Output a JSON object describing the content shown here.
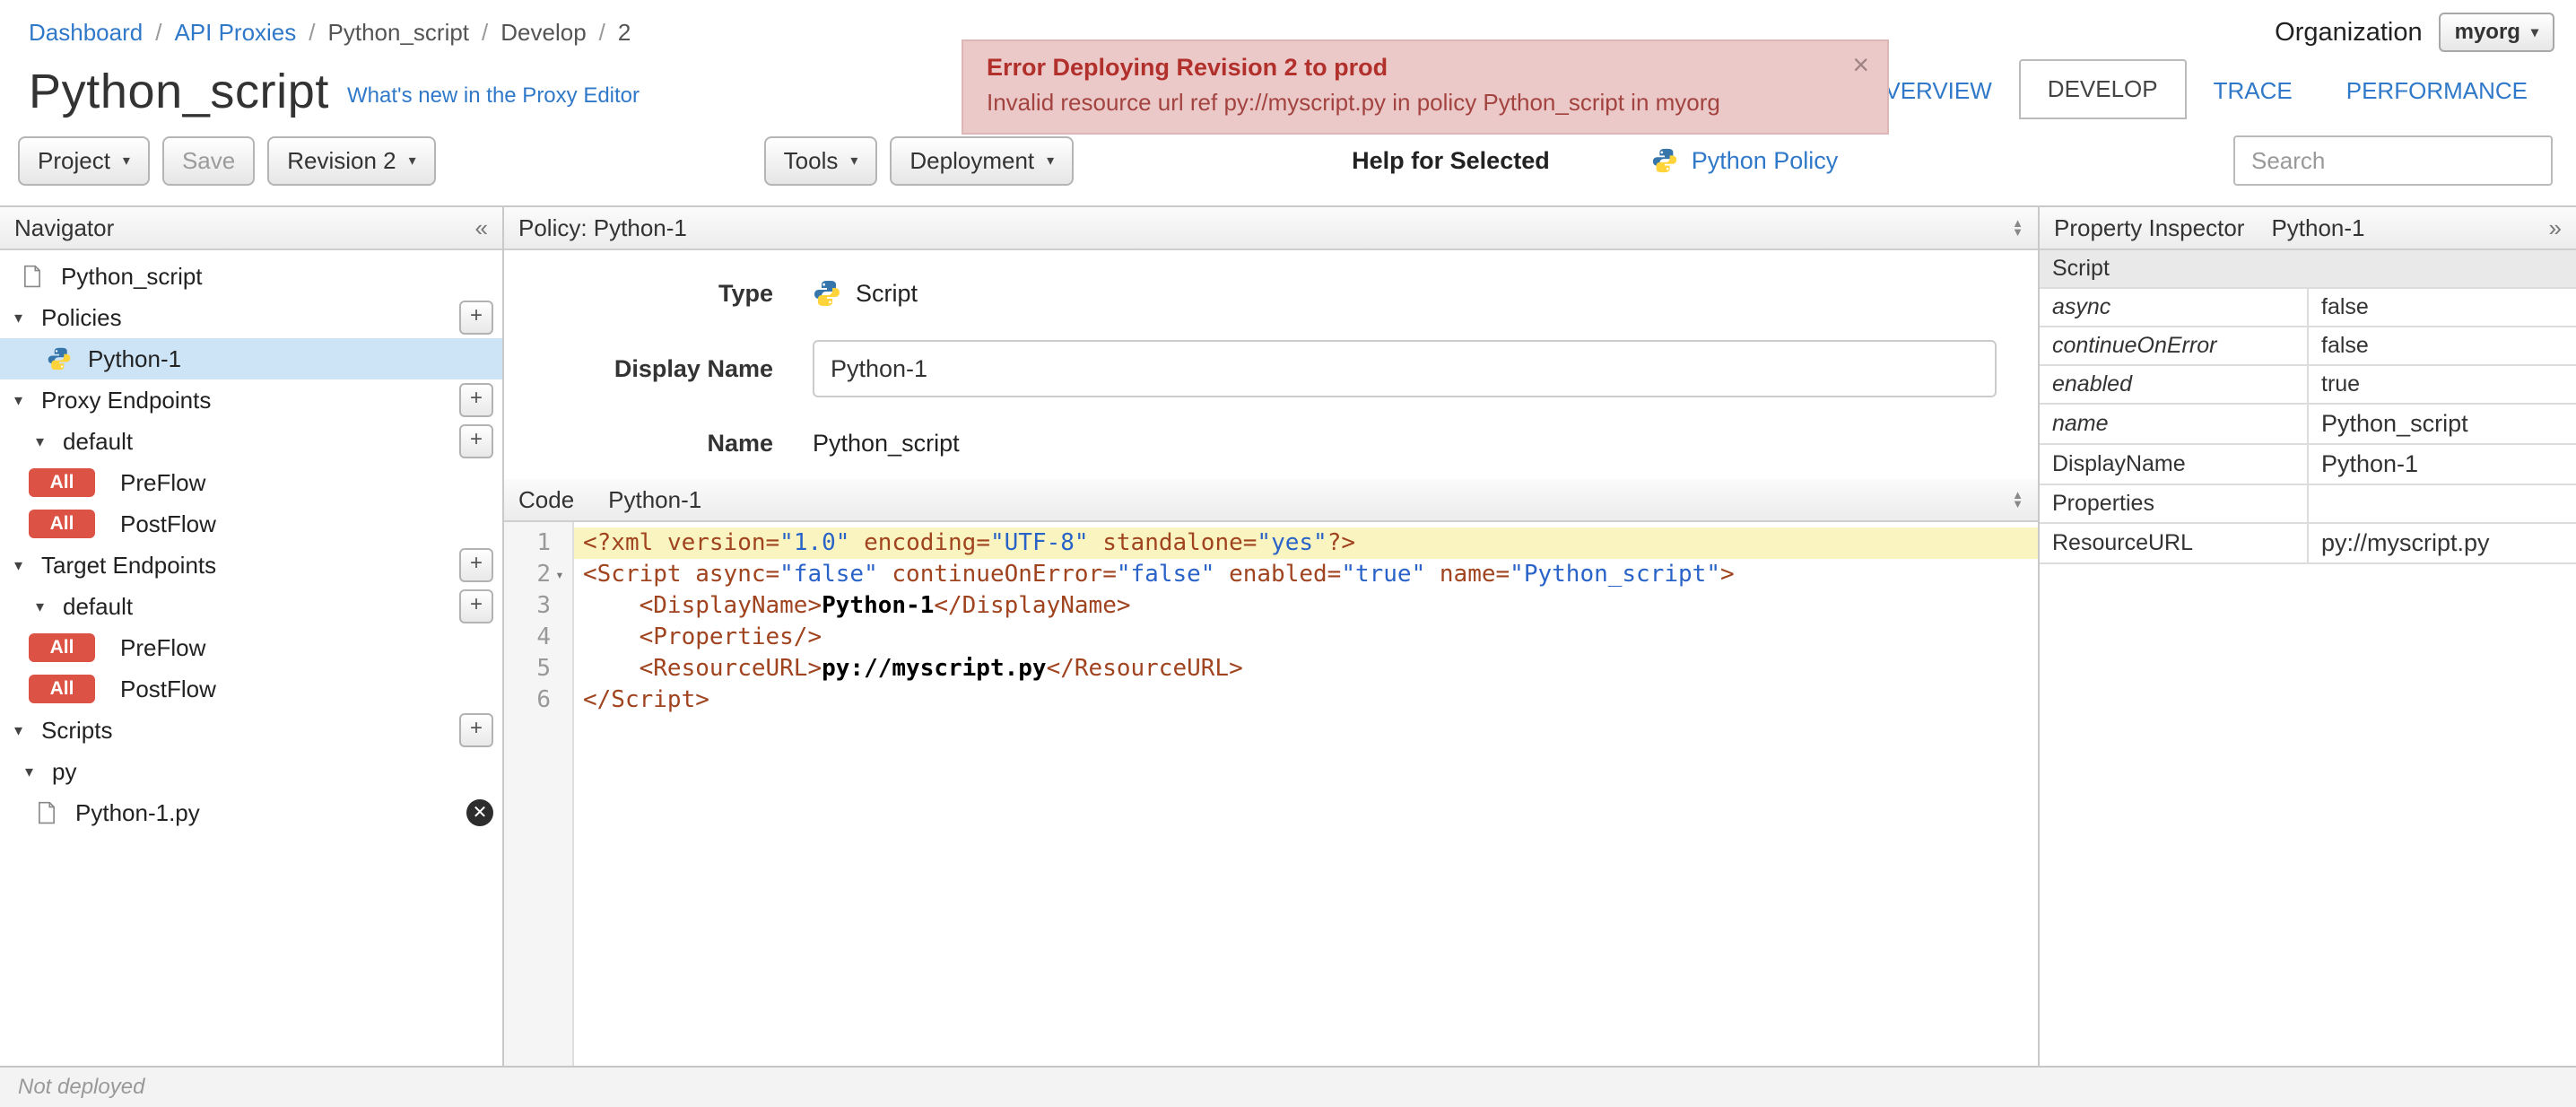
{
  "breadcrumb": {
    "items": [
      "Dashboard",
      "API Proxies",
      "Python_script",
      "Develop",
      "2"
    ],
    "separator": "/"
  },
  "organization": {
    "label": "Organization",
    "value": "myorg"
  },
  "error_banner": {
    "title": "Error Deploying Revision 2 to prod",
    "message": "Invalid resource url ref py://myscript.py in policy Python_script in myorg",
    "close": "×"
  },
  "header": {
    "title": "Python_script",
    "whats_new": "What's new in the Proxy Editor"
  },
  "tabs": {
    "overview": "OVERVIEW",
    "develop": "DEVELOP",
    "trace": "TRACE",
    "performance": "PERFORMANCE"
  },
  "toolbar": {
    "project": "Project",
    "save": "Save",
    "revision": "Revision 2",
    "tools": "Tools",
    "deployment": "Deployment",
    "help_for_selected": "Help for Selected",
    "policy_link": "Python Policy",
    "search_placeholder": "Search"
  },
  "navigator": {
    "title": "Navigator",
    "collapse": "«",
    "proxy_name": "Python_script",
    "policies": {
      "label": "Policies",
      "items": [
        {
          "label": "Python-1"
        }
      ]
    },
    "proxy_endpoints": {
      "label": "Proxy Endpoints",
      "group": "default",
      "flows": [
        {
          "badge": "All",
          "label": "PreFlow"
        },
        {
          "badge": "All",
          "label": "PostFlow"
        }
      ]
    },
    "target_endpoints": {
      "label": "Target Endpoints",
      "group": "default",
      "flows": [
        {
          "badge": "All",
          "label": "PreFlow"
        },
        {
          "badge": "All",
          "label": "PostFlow"
        }
      ]
    },
    "scripts": {
      "label": "Scripts",
      "group": "py",
      "files": [
        {
          "label": "Python-1.py"
        }
      ]
    }
  },
  "policy_panel": {
    "title": "Policy: Python-1",
    "type_label": "Type",
    "type_value": "Script",
    "display_name_label": "Display Name",
    "display_name_value": "Python-1",
    "name_label": "Name",
    "name_value": "Python_script"
  },
  "code_panel": {
    "label": "Code",
    "file": "Python-1",
    "active_line": 1,
    "fold_line": 2,
    "lines": [
      [
        [
          "tag",
          "<?xml"
        ],
        [
          "plain",
          " "
        ],
        [
          "attr",
          "version="
        ],
        [
          "str",
          "\"1.0\""
        ],
        [
          "plain",
          " "
        ],
        [
          "attr",
          "encoding="
        ],
        [
          "str",
          "\"UTF-8\""
        ],
        [
          "plain",
          " "
        ],
        [
          "attr",
          "standalone="
        ],
        [
          "str",
          "\"yes\""
        ],
        [
          "tag",
          "?>"
        ]
      ],
      [
        [
          "tag",
          "<Script"
        ],
        [
          "plain",
          " "
        ],
        [
          "attr",
          "async="
        ],
        [
          "str",
          "\"false\""
        ],
        [
          "plain",
          " "
        ],
        [
          "attr",
          "continueOnError="
        ],
        [
          "str",
          "\"false\""
        ],
        [
          "plain",
          " "
        ],
        [
          "attr",
          "enabled="
        ],
        [
          "str",
          "\"true\""
        ],
        [
          "plain",
          " "
        ],
        [
          "attr",
          "name="
        ],
        [
          "str",
          "\"Python_script\""
        ],
        [
          "tag",
          ">"
        ]
      ],
      [
        [
          "plain",
          "    "
        ],
        [
          "tag",
          "<DisplayName>"
        ],
        [
          "text",
          "Python-1"
        ],
        [
          "tag",
          "</DisplayName>"
        ]
      ],
      [
        [
          "plain",
          "    "
        ],
        [
          "tag",
          "<Properties/>"
        ]
      ],
      [
        [
          "plain",
          "    "
        ],
        [
          "tag",
          "<ResourceURL>"
        ],
        [
          "text",
          "py://myscript.py"
        ],
        [
          "tag",
          "</ResourceURL>"
        ]
      ],
      [
        [
          "tag",
          "</Script>"
        ]
      ]
    ]
  },
  "inspector": {
    "title": "Property Inspector",
    "subtitle": "Python-1",
    "expand": "»",
    "section": "Script",
    "rows": [
      {
        "key": "async",
        "value": "false"
      },
      {
        "key": "continueOnError",
        "value": "false"
      },
      {
        "key": "enabled",
        "value": "true"
      },
      {
        "key": "name",
        "value": "Python_script"
      },
      {
        "key": "DisplayName",
        "value": "Python-1"
      },
      {
        "key": "Properties",
        "value": ""
      },
      {
        "key": "ResourceURL",
        "value": "py://myscript.py"
      }
    ]
  },
  "status_bar": {
    "text": "Not deployed"
  }
}
